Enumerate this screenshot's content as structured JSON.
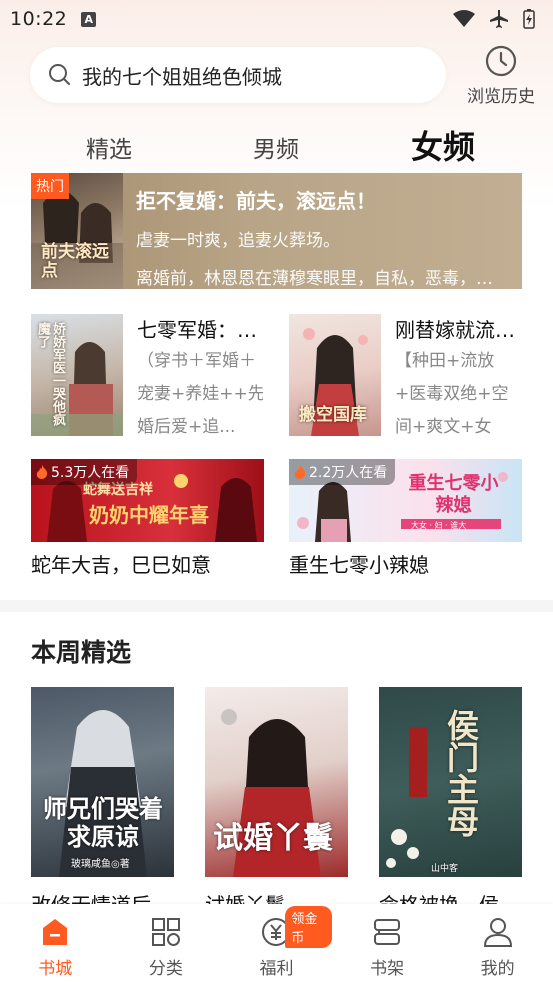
{
  "status": {
    "time": "10:22",
    "a_icon_label": "A"
  },
  "search": {
    "placeholder": "我的七个姐姐绝色倾城",
    "history_label": "浏览历史"
  },
  "tabs": [
    "精选",
    "男频",
    "女频"
  ],
  "hot": {
    "tag": "热门",
    "title": "拒不复婚：前夫，滚远点！",
    "subtitle": "虐妻一时爽，追妻火葬场。",
    "desc": "离婚前，林恩恩在薄穆寒眼里，自私，恶毒，虚荣...",
    "cover_text": "前夫滚远点"
  },
  "books": [
    {
      "title": "七零军婚：娇...",
      "desc": "（穿书＋军婚＋宠妻+养娃++先婚后爱+追...",
      "cover_text": "娇娇军医一哭他疯魔了"
    },
    {
      "title": "刚替嫁就流放...",
      "desc": "【种田+流放+医毒双绝+空间+爽文+女强...",
      "cover_text": "搬空国库"
    }
  ],
  "promos": [
    {
      "viewers": "5.3万人在看",
      "caption": "蛇年大吉，巳巳如意",
      "art_title": "奶奶中耀年喜",
      "art_sub": "蛇舞送吉祥"
    },
    {
      "viewers": "2.2万人在看",
      "caption": "重生七零小辣媳",
      "art_title": "重生七零小辣媳",
      "art_sub": "大女 · 妇 · 谁大"
    }
  ],
  "weekly": {
    "section_title": "本周精选",
    "items": [
      {
        "title": "改修无情道后...",
        "cover_text": "师兄们哭着求原谅",
        "cover_author": "玻璃咸鱼◎著"
      },
      {
        "title": "试婚丫鬟",
        "cover_text": "试婚丫鬟",
        "cover_author": ""
      },
      {
        "title": "命格被换，侯...",
        "cover_text": "侯门主母",
        "cover_author": "山中客"
      }
    ]
  },
  "nav": [
    {
      "label": "书城",
      "icon": "home-icon",
      "active": true
    },
    {
      "label": "分类",
      "icon": "grid-icon",
      "active": false
    },
    {
      "label": "福利",
      "icon": "yuan-coin-icon",
      "active": false,
      "badge": "领金币"
    },
    {
      "label": "书架",
      "icon": "bookshelf-icon",
      "active": false
    },
    {
      "label": "我的",
      "icon": "person-icon",
      "active": false
    }
  ],
  "colors": {
    "accent": "#ff5a1f",
    "banner_bg": "#b5a080"
  }
}
